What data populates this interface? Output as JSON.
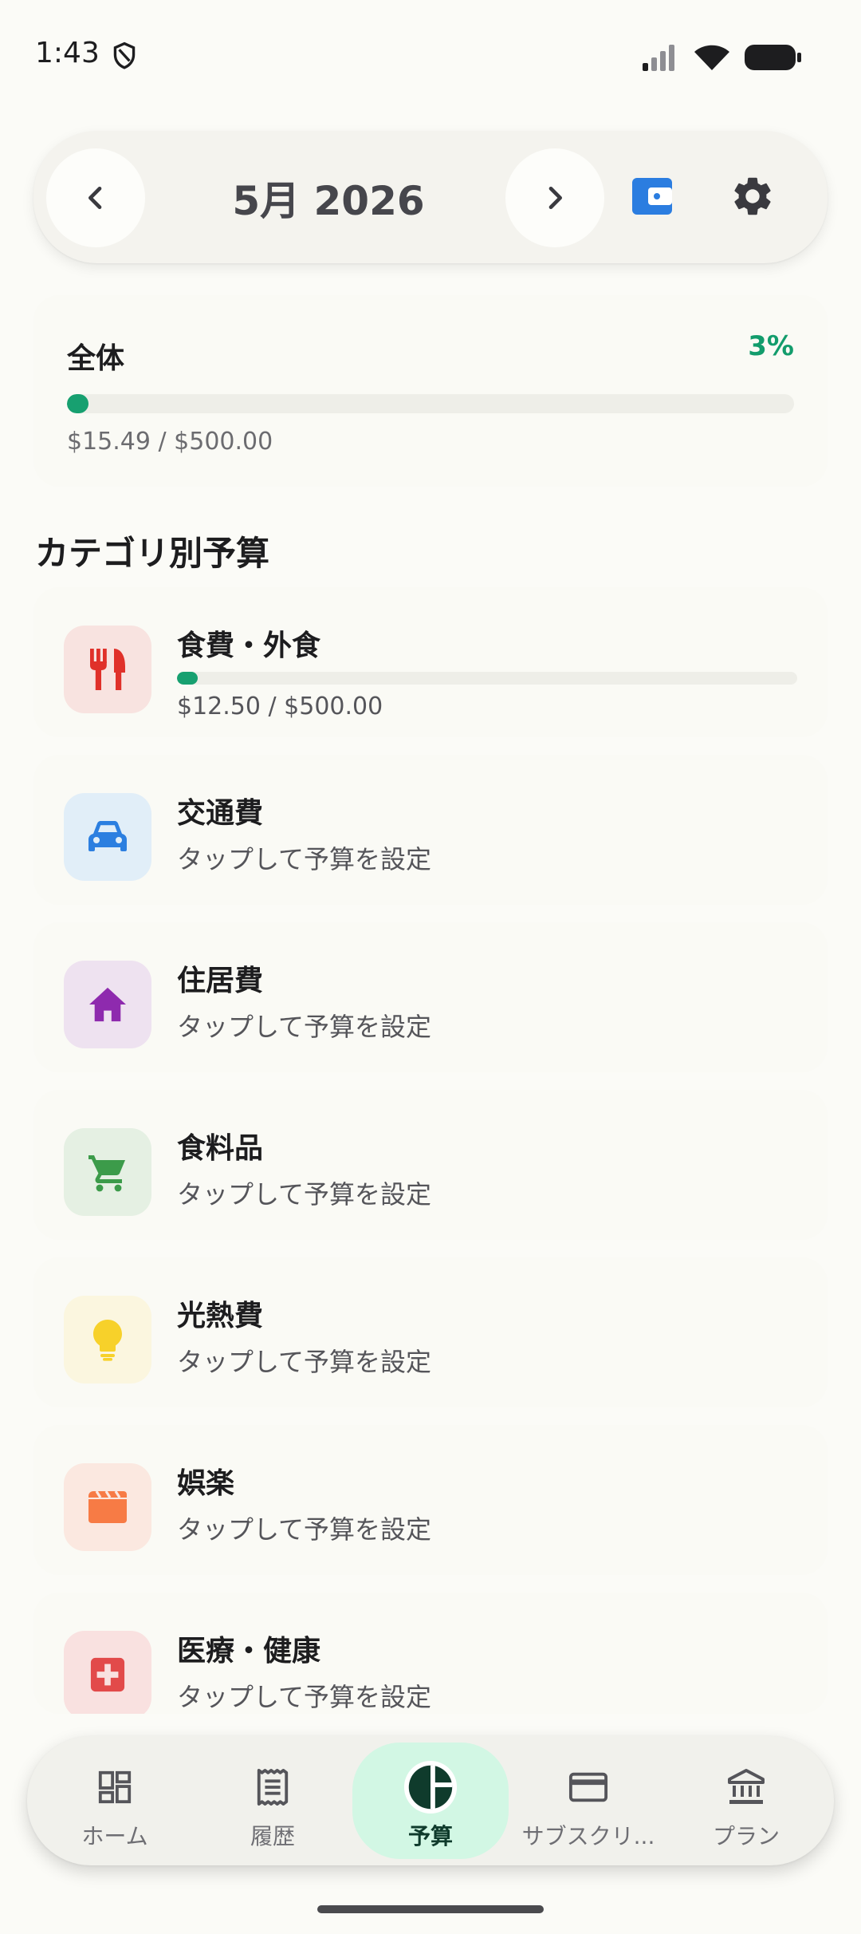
{
  "status_bar": {
    "time": "1:43"
  },
  "header": {
    "month_label": "5月 2026"
  },
  "overall": {
    "title": "全体",
    "percent_label": "3%",
    "progress": 0.03,
    "amount": "$15.49 / $500.00"
  },
  "section_title": "カテゴリ別予算",
  "categories": [
    {
      "name": "食費・外食",
      "amount": "$12.50 / $500.00",
      "progress": 0.025,
      "icon": "fork-knife-icon",
      "icon_color": "#E0312A",
      "bg_color": "#F8E3E0"
    },
    {
      "name": "交通費",
      "subtitle": "タップして予算を設定",
      "icon": "car-icon",
      "icon_color": "#2C7FE0",
      "bg_color": "#E1EEF8"
    },
    {
      "name": "住居費",
      "subtitle": "タップして予算を設定",
      "icon": "house-icon",
      "icon_color": "#8E2AAE",
      "bg_color": "#EEE2F0"
    },
    {
      "name": "食料品",
      "subtitle": "タップして予算を設定",
      "icon": "cart-icon",
      "icon_color": "#3C9B4A",
      "bg_color": "#E5F0E3"
    },
    {
      "name": "光熱費",
      "subtitle": "タップして予算を設定",
      "icon": "lightbulb-icon",
      "icon_color": "#F7D12A",
      "bg_color": "#FBF6DF"
    },
    {
      "name": "娯楽",
      "subtitle": "タップして予算を設定",
      "icon": "clapperboard-icon",
      "icon_color": "#F77B45",
      "bg_color": "#FBE8E0"
    },
    {
      "name": "医療・健康",
      "subtitle": "タップして予算を設定",
      "icon": "medical-cross-icon",
      "icon_color": "#E24A4A",
      "bg_color": "#F9E1E0"
    }
  ],
  "bottom_nav": {
    "items": [
      {
        "label": "ホーム",
        "icon": "dashboard-icon"
      },
      {
        "label": "履歴",
        "icon": "receipt-icon"
      },
      {
        "label": "予算",
        "icon": "pie-chart-icon",
        "active": true
      },
      {
        "label": "サブスクリ...",
        "icon": "credit-card-icon"
      },
      {
        "label": "プラン",
        "icon": "bank-icon"
      }
    ]
  },
  "colors": {
    "accent_green": "#17A070",
    "active_nav_bg": "#D2F7E4",
    "wallet_blue": "#2B7DE0"
  }
}
